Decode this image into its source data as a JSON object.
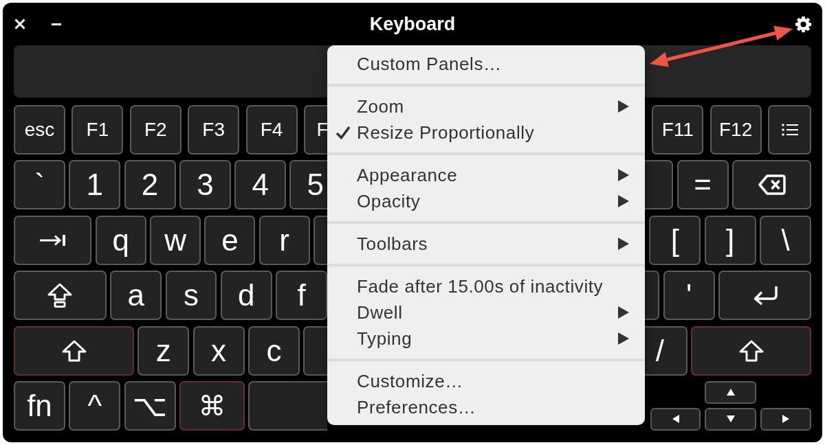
{
  "window": {
    "title": "Keyboard"
  },
  "keyboard": {
    "rows": [
      {
        "left": [
          {
            "kind": "fkey",
            "label": "esc",
            "highlighted": false
          },
          {
            "kind": "fkey",
            "label": "F1",
            "highlighted": false
          },
          {
            "kind": "fkey",
            "label": "F2",
            "highlighted": false
          },
          {
            "kind": "fkey",
            "label": "F3",
            "highlighted": false
          },
          {
            "kind": "fkey",
            "label": "F4",
            "highlighted": false
          },
          {
            "kind": "fkey",
            "label": "F",
            "partial": true,
            "highlighted": false
          }
        ],
        "right": [
          {
            "kind": "fkey",
            "label": "F11",
            "highlighted": false
          },
          {
            "kind": "fkey",
            "label": "F12",
            "highlighted": false
          },
          {
            "kind": "list",
            "highlighted": false
          }
        ]
      },
      {
        "left": [
          {
            "kind": "key",
            "label": "`",
            "highlighted": false
          },
          {
            "kind": "key",
            "label": "1",
            "highlighted": false
          },
          {
            "kind": "key",
            "label": "2",
            "highlighted": false
          },
          {
            "kind": "key",
            "label": "3",
            "highlighted": false
          },
          {
            "kind": "key",
            "label": "4",
            "highlighted": false
          },
          {
            "kind": "key",
            "label": "5",
            "partial": true,
            "highlighted": false
          }
        ],
        "right": [
          {
            "kind": "key",
            "partial": true,
            "highlighted": false
          },
          {
            "kind": "key",
            "label": "=",
            "highlighted": false
          },
          {
            "kind": "backspace",
            "highlighted": false
          }
        ]
      },
      {
        "left": [
          {
            "kind": "tab",
            "highlighted": false
          },
          {
            "kind": "key",
            "label": "q",
            "highlighted": false
          },
          {
            "kind": "key",
            "label": "w",
            "highlighted": false
          },
          {
            "kind": "key",
            "label": "e",
            "highlighted": false
          },
          {
            "kind": "key",
            "label": "r",
            "highlighted": false
          },
          {
            "kind": "key",
            "partial": true,
            "highlighted": false
          }
        ],
        "right": [
          {
            "kind": "key",
            "label": "[",
            "highlighted": false
          },
          {
            "kind": "key",
            "label": "]",
            "highlighted": false
          },
          {
            "kind": "key",
            "label": "\\",
            "highlighted": false
          }
        ]
      },
      {
        "left": [
          {
            "kind": "caps",
            "highlighted": false
          },
          {
            "kind": "key",
            "label": "a",
            "highlighted": false
          },
          {
            "kind": "key",
            "label": "s",
            "highlighted": false
          },
          {
            "kind": "key",
            "label": "d",
            "highlighted": false
          },
          {
            "kind": "key",
            "label": "f",
            "highlighted": false
          }
        ],
        "right": [
          {
            "kind": "key",
            "partial": true,
            "highlighted": false
          },
          {
            "kind": "key",
            "label": "'",
            "highlighted": false
          },
          {
            "kind": "return",
            "highlighted": false
          }
        ]
      },
      {
        "left": [
          {
            "kind": "shift",
            "highlighted": true
          },
          {
            "kind": "key",
            "label": "z",
            "highlighted": false
          },
          {
            "kind": "key",
            "label": "x",
            "highlighted": false
          },
          {
            "kind": "key",
            "label": "c",
            "highlighted": false
          },
          {
            "kind": "key",
            "partial": true,
            "highlighted": false
          }
        ],
        "right": [
          {
            "kind": "key",
            "label": "/",
            "partial": true,
            "highlighted": false
          },
          {
            "kind": "shift",
            "highlighted": true
          }
        ]
      },
      {
        "left": [
          {
            "kind": "key",
            "label": "fn",
            "highlighted": false
          },
          {
            "kind": "key",
            "label": "^",
            "highlighted": false
          },
          {
            "kind": "key",
            "label": "⌥",
            "highlighted": false
          },
          {
            "kind": "command",
            "label": "⌘",
            "highlighted": true
          },
          {
            "kind": "space",
            "partial": true,
            "highlighted": false
          }
        ],
        "right": [
          {
            "kind": "arrow-up",
            "highlighted": false
          },
          {
            "kind": "arrow-left",
            "highlighted": false
          },
          {
            "kind": "arrow-down",
            "highlighted": false
          },
          {
            "kind": "arrow-right",
            "highlighted": false
          }
        ]
      }
    ]
  },
  "menu": {
    "groups": [
      {
        "items": [
          {
            "label": "Custom Panels…",
            "checked": false,
            "submenu": false
          }
        ]
      },
      {
        "items": [
          {
            "label": "Zoom",
            "checked": false,
            "submenu": true
          },
          {
            "label": "Resize Proportionally",
            "checked": true,
            "submenu": false
          }
        ]
      },
      {
        "items": [
          {
            "label": "Appearance",
            "checked": false,
            "submenu": true
          },
          {
            "label": "Opacity",
            "checked": false,
            "submenu": true
          }
        ]
      },
      {
        "items": [
          {
            "label": "Toolbars",
            "checked": false,
            "submenu": true
          }
        ]
      },
      {
        "items": [
          {
            "label": "Fade after 15.00s of inactivity",
            "checked": false,
            "submenu": false
          },
          {
            "label": "Dwell",
            "checked": false,
            "submenu": true
          },
          {
            "label": "Typing",
            "checked": false,
            "submenu": true
          }
        ]
      },
      {
        "items": [
          {
            "label": "Customize…",
            "checked": false,
            "submenu": false
          },
          {
            "label": "Preferences…",
            "checked": false,
            "submenu": false
          }
        ]
      }
    ]
  }
}
